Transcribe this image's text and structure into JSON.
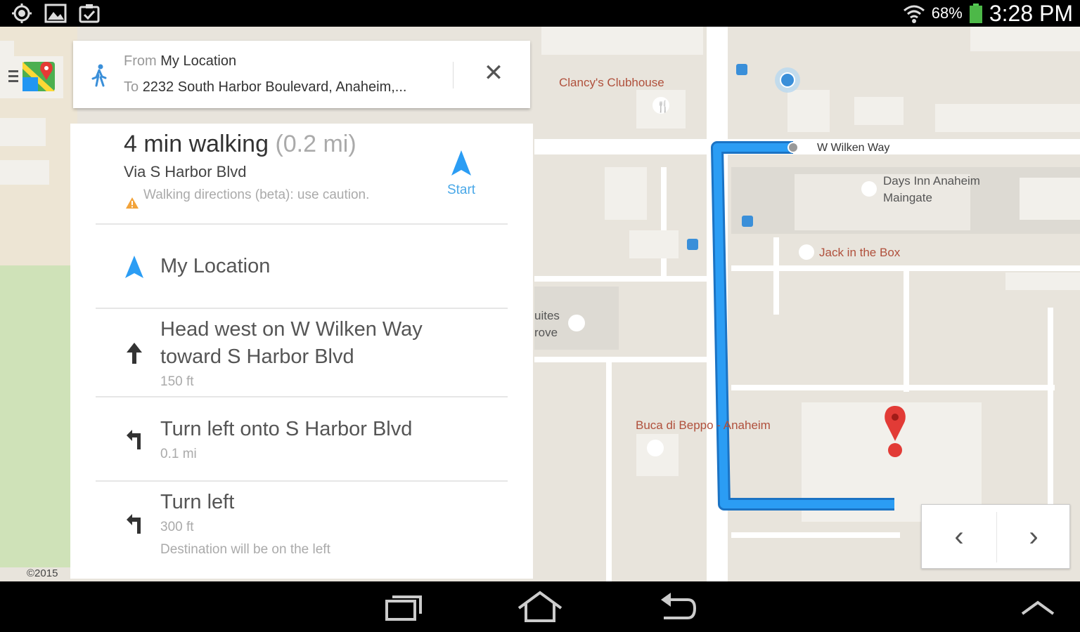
{
  "status_bar": {
    "battery_percent": "68%",
    "clock": "3:28 PM",
    "left_icons": [
      "location-icon",
      "image-icon",
      "clipboard-icon"
    ]
  },
  "route_header": {
    "from_prefix": "From",
    "from_value": "My Location",
    "to_prefix": "To",
    "to_value": "2232 South Harbor Boulevard, Anaheim,...",
    "travel_mode_icon": "walking-icon",
    "close_label": "✕"
  },
  "summary": {
    "time": "4 min walking",
    "distance": "(0.2 mi)",
    "via": "Via S Harbor Blvd",
    "warning": "Walking directions (beta): use caution.",
    "start_label": "Start"
  },
  "steps": [
    {
      "icon": "navigation-arrow-icon",
      "lines": [
        "My Location"
      ],
      "distance": "",
      "note": ""
    },
    {
      "icon": "arrow-up-icon",
      "lines": [
        "Head west on W Wilken Way",
        "toward S Harbor Blvd"
      ],
      "distance": "150 ft",
      "note": ""
    },
    {
      "icon": "turn-left-icon",
      "lines": [
        "Turn left onto S Harbor Blvd"
      ],
      "distance": "0.1 mi",
      "note": ""
    },
    {
      "icon": "turn-left-icon",
      "lines": [
        "Turn left"
      ],
      "distance": "300 ft",
      "note": "Destination will be on the left"
    }
  ],
  "map": {
    "street_label": "W Wilken Way",
    "pois": [
      "Clancy's Clubhouse",
      "Days Inn Anaheim",
      "Maingate",
      "Jack in the Box",
      "Buca di Beppo - Anaheim",
      "uites",
      "rove"
    ],
    "copyright": "©2015",
    "route_color": "#2b9df4",
    "marker_color": "#e23b36"
  },
  "pager": {
    "prev": "‹",
    "next": "›"
  },
  "nav_bar": [
    "recent-apps-icon",
    "home-icon",
    "back-icon",
    "up-chevron-icon"
  ]
}
